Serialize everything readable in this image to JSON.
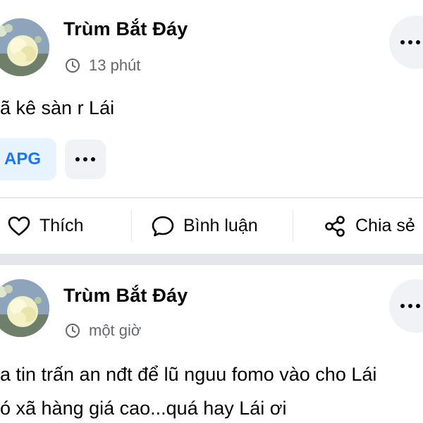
{
  "posts": [
    {
      "author": "Trùm Bắt Đáy",
      "time": "13 phút",
      "time_icon": "clock-icon",
      "body": [
        "ã kê sàn r Lái"
      ],
      "tag": "APG",
      "more_icon": "more-dots-icon"
    },
    {
      "author": "Trùm Bắt Đáy",
      "time": "một giờ",
      "time_icon": "clock-icon",
      "body": [
        "a tin trấn an nđt để lũ nguu fomo vào cho Lái",
        "ó xã hàng giá cao...quá hay Lái ơi"
      ],
      "more_icon": "more-dots-icon"
    }
  ],
  "actions": {
    "like": "Thích",
    "comment": "Bình luận",
    "share": "Chia sẻ"
  },
  "colors": {
    "text": "#050505",
    "secondary": "#65676b",
    "tag_bg": "#e7f3ff",
    "tag_text": "#1877f2",
    "button_bg": "#f0f2f5",
    "separator": "#e4e6eb"
  }
}
